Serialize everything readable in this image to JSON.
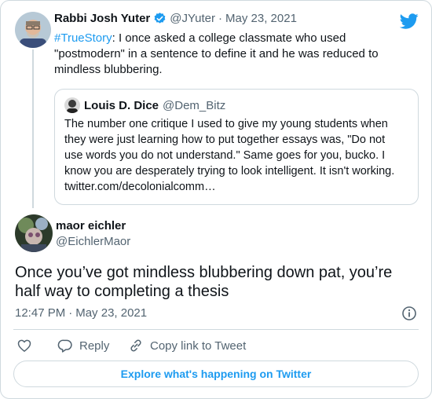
{
  "colors": {
    "accent": "#1d9bf0",
    "text": "#0f1419",
    "muted": "#536471",
    "border": "#cfd9de"
  },
  "parent_tweet": {
    "author_name": "Rabbi Josh Yuter",
    "author_handle": "@JYuter",
    "separator": "·",
    "date": "May 23, 2021",
    "hashtag": "#TrueStory",
    "text_line1_rest": ": I once asked a college classmate who used",
    "text_line2": "\"postmodern\" in a sentence to define it and he was reduced to",
    "text_line3": "mindless blubbering."
  },
  "quoted_tweet": {
    "author_name": "Louis D. Dice",
    "author_handle": "@Dem_Bitz",
    "lines": [
      "The number one critique I used to give my young students when",
      "they were just learning how to put together essays was, \"Do not",
      "use words you do not understand.\" Same goes for you, bucko. I",
      "know you are desperately trying to look intelligent. It isn't working.",
      "twitter.com/decolonialcomm…"
    ]
  },
  "main_tweet": {
    "author_name": "maor eichler",
    "author_handle": "@EichlerMaor",
    "text_line1": "Once you’ve got mindless blubbering down pat, you’re",
    "text_line2": "half way to completing a thesis",
    "time": "12:47 PM",
    "separator": "·",
    "date": "May 23, 2021"
  },
  "actions": {
    "reply_label": "Reply",
    "copy_label": "Copy link to Tweet"
  },
  "explore_label": "Explore what's happening on Twitter",
  "icons": {
    "logo": "twitter-bird-icon",
    "verified": "verified-badge-icon",
    "info": "info-icon",
    "like": "heart-icon",
    "reply": "reply-icon",
    "copy": "link-icon"
  }
}
